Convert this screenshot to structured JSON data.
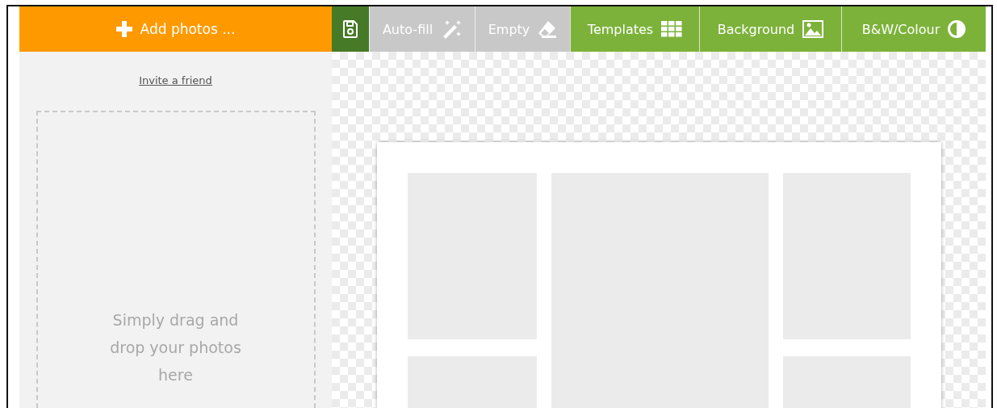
{
  "toolbar": {
    "add_button": {
      "label": "Add photos ..."
    },
    "tools": [
      {
        "kind": "save",
        "disabled": false
      },
      {
        "kind": "autofill",
        "label": "Auto-fill",
        "disabled": true
      },
      {
        "kind": "empty",
        "label": "Empty",
        "disabled": true
      },
      {
        "kind": "templates",
        "label": "Templates",
        "disabled": false
      },
      {
        "kind": "background",
        "label": "Background",
        "disabled": false
      },
      {
        "kind": "colour",
        "label": "B&W/Colour",
        "disabled": false
      }
    ]
  },
  "sidebar": {
    "invite_link": "Invite a friend",
    "dropzone_text": "Simply drag and drop your photos here"
  },
  "canvas": {
    "slots": [
      {
        "kind": "small"
      },
      {
        "kind": "tall"
      },
      {
        "kind": "small"
      },
      {
        "kind": "small"
      },
      {
        "kind": "small"
      }
    ]
  }
}
